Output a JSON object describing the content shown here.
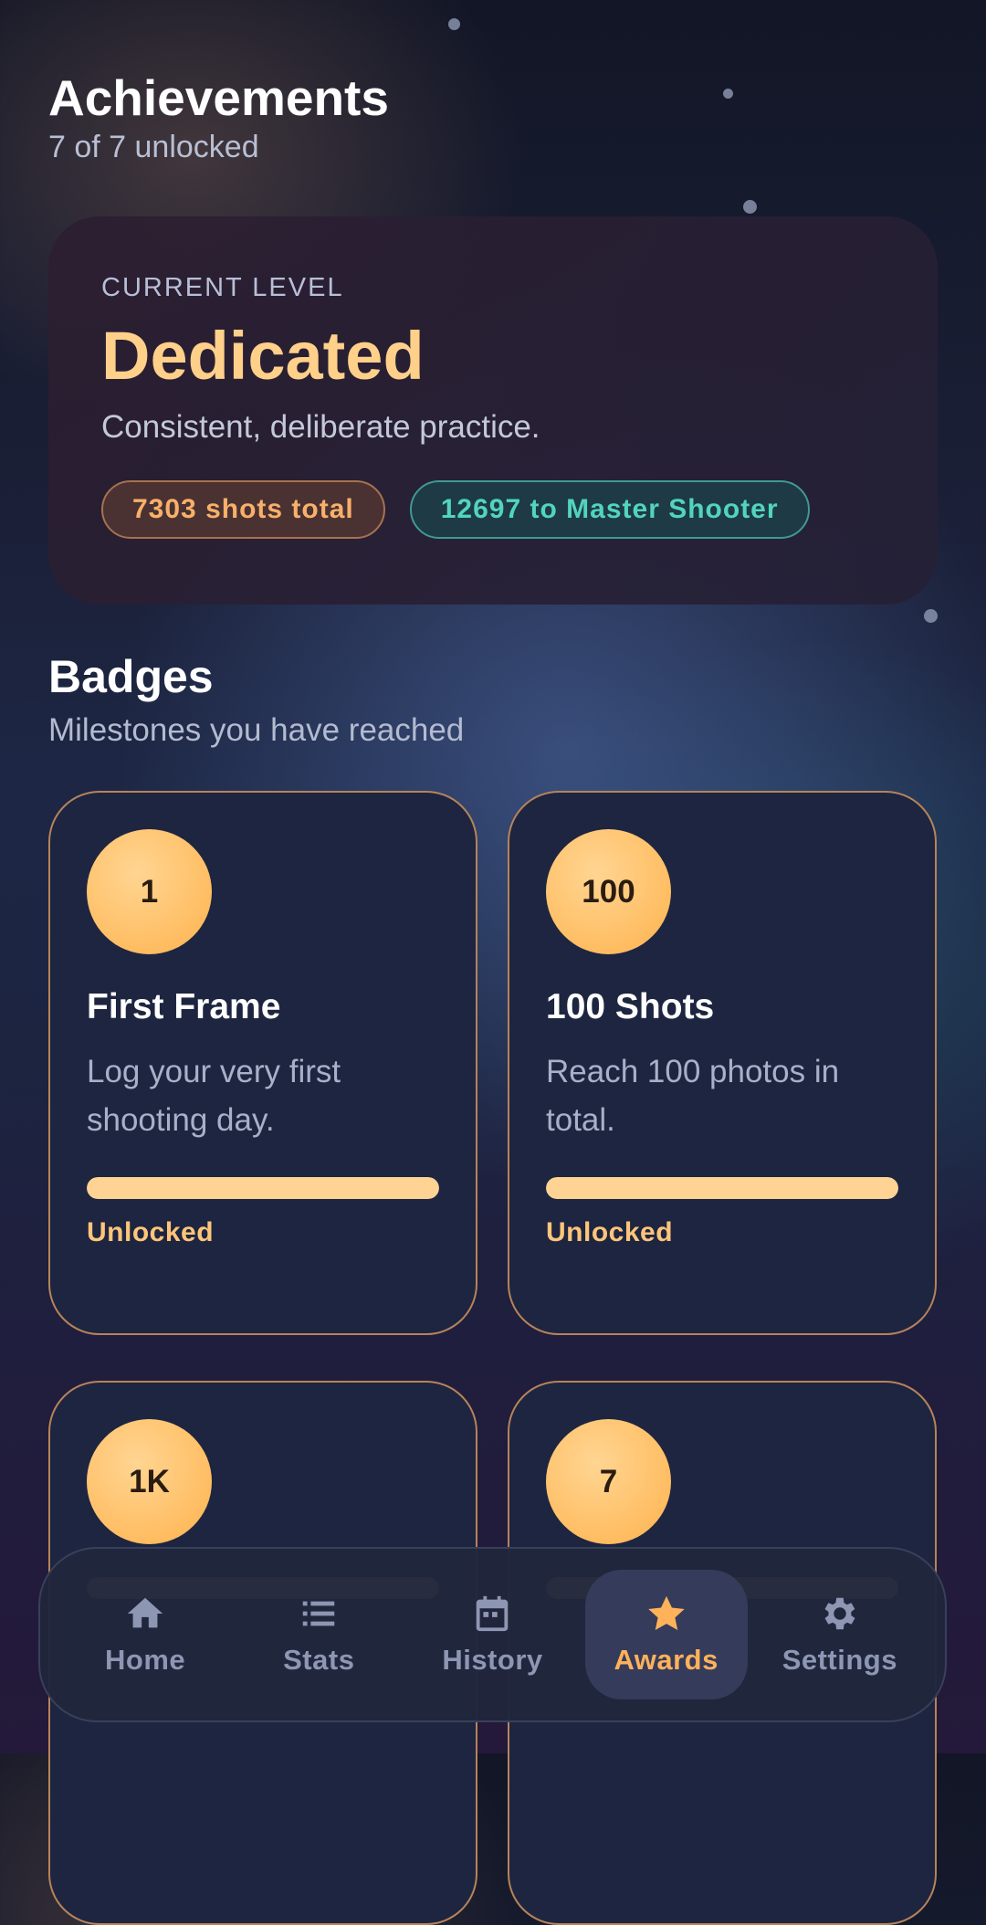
{
  "header": {
    "title": "Achievements",
    "subtitle": "7 of 7 unlocked"
  },
  "level": {
    "eyebrow": "CURRENT LEVEL",
    "name": "Dedicated",
    "description": "Consistent, deliberate practice.",
    "shots_pill": "7303 shots total",
    "next_pill": "12697 to Master Shooter"
  },
  "badges_section": {
    "title": "Badges",
    "subtitle": "Milestones you have reached"
  },
  "badges": [
    {
      "icon_text": "1",
      "name": "First Frame",
      "description": "Log your very first shooting day.",
      "progress": 1.0,
      "status": "Unlocked"
    },
    {
      "icon_text": "100",
      "name": "100 Shots",
      "description": "Reach 100 photos in total.",
      "progress": 1.0,
      "status": "Unlocked"
    },
    {
      "icon_text": "1K",
      "name": "",
      "description": "",
      "progress": 1.0,
      "status": ""
    },
    {
      "icon_text": "7",
      "name": "",
      "description": "",
      "progress": 1.0,
      "status": ""
    }
  ],
  "nav": {
    "items": [
      {
        "label": "Home",
        "icon": "home-icon"
      },
      {
        "label": "Stats",
        "icon": "list-icon"
      },
      {
        "label": "History",
        "icon": "calendar-icon"
      },
      {
        "label": "Awards",
        "icon": "star-icon",
        "active": true
      },
      {
        "label": "Settings",
        "icon": "gear-icon"
      }
    ]
  },
  "colors": {
    "accent": "#ffd08a",
    "active_nav": "#ffb25a",
    "teal": "#52d4be"
  }
}
